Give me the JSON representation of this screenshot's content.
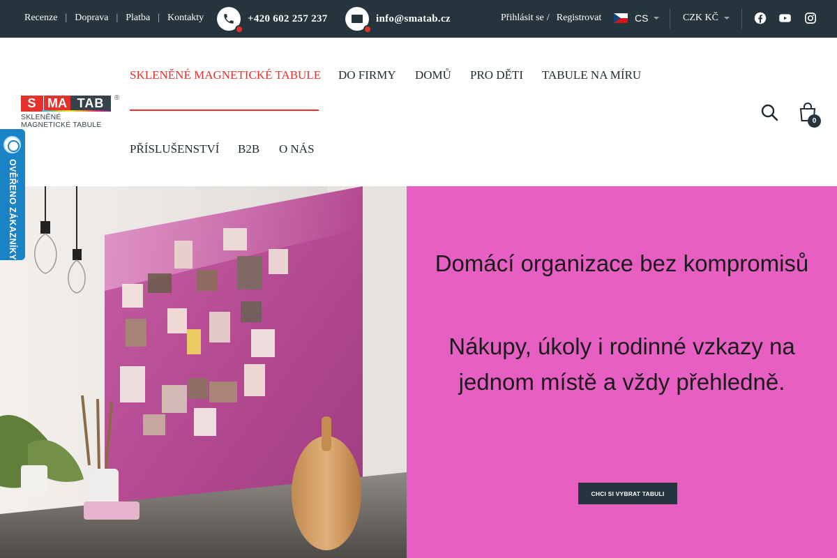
{
  "topbar": {
    "links": [
      "Recenze",
      "Doprava",
      "Platba",
      "Kontakty"
    ],
    "separator": "|",
    "phone": "+420 602 257 237",
    "email": "info@smatab.cz",
    "login": "Přihlásit se",
    "login_sep": "/",
    "register": "Registrovat",
    "language": "CS",
    "currency": "CZK KČ",
    "social_icons": [
      "facebook-icon",
      "youtube-icon",
      "instagram-icon"
    ]
  },
  "logo": {
    "part1": "SMA",
    "part2": "TAB",
    "registered": "®",
    "tagline_line1": "SKLENĚNÉ",
    "tagline_line2": "MAGNETICKÉ TABULE"
  },
  "nav": {
    "items": [
      "SKLENĚNÉ MAGNETICKÉ TABULE",
      "DO FIRMY",
      "DOMŮ",
      "PRO DĚTI",
      "TABULE NA MÍRU",
      "PŘÍSLUŠENSTVÍ",
      "B2B",
      "O NÁS"
    ],
    "active_index": 0
  },
  "cart": {
    "count": "0"
  },
  "verified_widget": {
    "label": "OVĚŘENO ZÁKAZNÍKY"
  },
  "hero": {
    "title": "Domácí organizace bez kompromisů",
    "subtitle": "Nákupy, úkoly i rodinné vzkazy na jednom místě a vždy přehledně.",
    "cta": "CHCI SI VYBRAT TABULI"
  },
  "colors": {
    "topbar_bg": "#26343d",
    "accent_red": "#e5312b",
    "hero_pink": "#e85fc3",
    "verified_blue": "#1a83c6"
  }
}
